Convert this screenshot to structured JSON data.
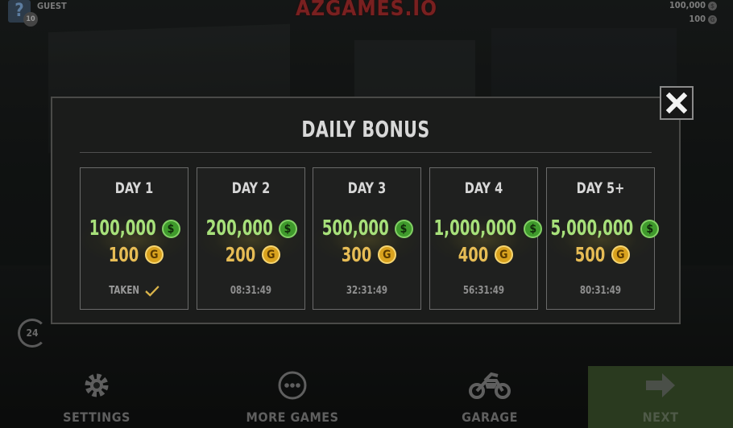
{
  "header": {
    "player_name": "GUEST",
    "level": "10",
    "avatar_letter": "?",
    "logo": "AZGAMES.IO",
    "cash": "100,000",
    "gold": "100"
  },
  "modal": {
    "title": "DAILY BONUS",
    "days": [
      {
        "label": "DAY 1",
        "cash": "100,000",
        "gold": "100",
        "status": "TAKEN",
        "claimed": true
      },
      {
        "label": "DAY 2",
        "cash": "200,000",
        "gold": "200",
        "status": "08:31:49",
        "claimed": false
      },
      {
        "label": "DAY 3",
        "cash": "500,000",
        "gold": "300",
        "status": "32:31:49",
        "claimed": false
      },
      {
        "label": "DAY 4",
        "cash": "1,000,000",
        "gold": "400",
        "status": "56:31:49",
        "claimed": false
      },
      {
        "label": "DAY 5+",
        "cash": "5,000,000",
        "gold": "500",
        "status": "80:31:49",
        "claimed": false
      }
    ],
    "cash_symbol": "$",
    "gold_symbol": "G"
  },
  "timer_badge": "24",
  "nav": {
    "settings": "SETTINGS",
    "more_games": "MORE GAMES",
    "garage": "GARAGE",
    "next": "NEXT"
  },
  "colors": {
    "cash_green": "#a7e07a",
    "gold_yellow": "#e6bc55",
    "modal_bg": "#1b1c1b"
  }
}
